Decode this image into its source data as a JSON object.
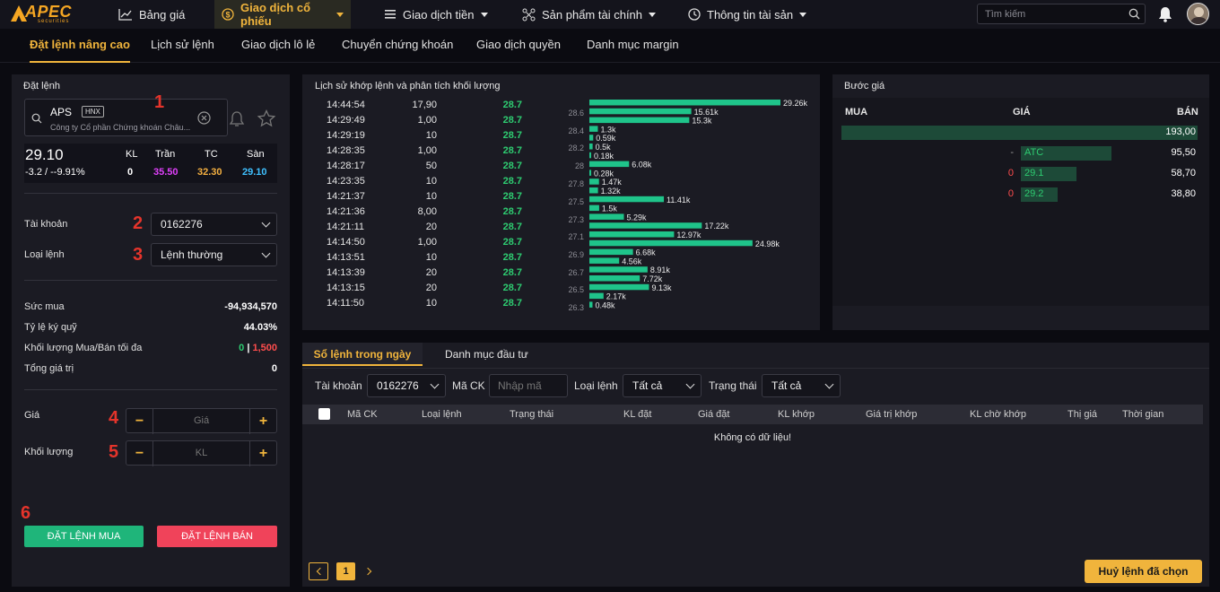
{
  "nav": {
    "logo_text": "APEC",
    "logo_sub": "securities",
    "items": [
      {
        "label": "Bảng giá",
        "icon": "chart-line-icon"
      },
      {
        "label": "Giao dịch cổ phiếu",
        "icon": "dollar-coin-icon"
      },
      {
        "label": "Giao dịch tiền",
        "icon": "list-icon"
      },
      {
        "label": "Sản phẩm tài chính",
        "icon": "network-icon"
      },
      {
        "label": "Thông tin tài sản",
        "icon": "clock-icon"
      }
    ],
    "search_placeholder": "Tìm kiếm"
  },
  "subnav": {
    "tabs": [
      "Đặt lệnh nâng cao",
      "Lịch sử lệnh",
      "Giao dịch lô lẻ",
      "Chuyển chứng khoán",
      "Giao dịch quyền",
      "Danh mục margin"
    ]
  },
  "order": {
    "title": "Đặt lệnh",
    "step_markers": [
      "1",
      "2",
      "3",
      "4",
      "5",
      "6"
    ],
    "symbol": "APS",
    "exchange": "HNX",
    "company": "Công ty Cổ phần Chứng khoán Châu...",
    "price": "29.10",
    "change": "-3.2 / --9.91%",
    "kl_label": "KL",
    "kl_value": "0",
    "tran_label": "Trần",
    "tran_value": "35.50",
    "tc_label": "TC",
    "tc_value": "32.30",
    "san_label": "Sàn",
    "san_value": "29.10",
    "account_label": "Tài khoản",
    "account_value": "0162276",
    "order_type_label": "Loại lệnh",
    "order_type_value": "Lệnh thường",
    "suc_mua_label": "Sức mua",
    "suc_mua_value": "-94,934,570",
    "ty_le_label": "Tỷ lệ ký quỹ",
    "ty_le_value": "44.03%",
    "max_label": "Khối lượng Mua/Bán tối đa",
    "max_buy": "0",
    "max_sep": " | ",
    "max_sell": "1,500",
    "total_label": "Tổng giá trị",
    "total_value": "0",
    "price_label": "Giá",
    "price_placeholder": "Giá",
    "qty_label": "Khối lượng",
    "qty_placeholder": "KL",
    "minus": "−",
    "plus": "+",
    "buy_button": "ĐẶT LỆNH MUA",
    "sell_button": "ĐẶT LỆNH BÁN"
  },
  "trades": {
    "title": "Lịch sử khớp lệnh và phân tích khối lượng",
    "rows": [
      {
        "time": "14:44:54",
        "vol": "17,90",
        "price": "28.7"
      },
      {
        "time": "14:29:49",
        "vol": "1,00",
        "price": "28.7"
      },
      {
        "time": "14:29:19",
        "vol": "10",
        "price": "28.7"
      },
      {
        "time": "14:28:35",
        "vol": "1,00",
        "price": "28.7"
      },
      {
        "time": "14:28:17",
        "vol": "50",
        "price": "28.7"
      },
      {
        "time": "14:23:35",
        "vol": "10",
        "price": "28.7"
      },
      {
        "time": "14:21:37",
        "vol": "10",
        "price": "28.7"
      },
      {
        "time": "14:21:36",
        "vol": "8,00",
        "price": "28.7"
      },
      {
        "time": "14:21:11",
        "vol": "20",
        "price": "28.7"
      },
      {
        "time": "14:14:50",
        "vol": "1,00",
        "price": "28.7"
      },
      {
        "time": "14:13:51",
        "vol": "10",
        "price": "28.7"
      },
      {
        "time": "14:13:39",
        "vol": "20",
        "price": "28.7"
      },
      {
        "time": "14:13:15",
        "vol": "20",
        "price": "28.7"
      },
      {
        "time": "14:11:50",
        "vol": "10",
        "price": "28.7"
      }
    ]
  },
  "chart_data": {
    "type": "bar",
    "orientation": "horizontal",
    "price_ticks": [
      "28.6",
      "28.4",
      "28.2",
      "28",
      "27.8",
      "27.5",
      "27.3",
      "27.1",
      "26.9",
      "26.7",
      "26.5",
      "26.3"
    ],
    "bar_color": "#1fc48a",
    "values": [
      29.26,
      15.61,
      15.3,
      1.3,
      0.59,
      0.5,
      0.18,
      6.08,
      0.28,
      1.47,
      1.32,
      11.41,
      1.5,
      5.29,
      17.22,
      12.97,
      24.98,
      6.68,
      4.56,
      8.91,
      7.72,
      9.13,
      2.17,
      0.48
    ],
    "labels": [
      "29.26k",
      "15.61k",
      "15.3k",
      "1.3k",
      "0.59k",
      "0.5k",
      "0.18k",
      "6.08k",
      "0.28k",
      "1.47k",
      "1.32k",
      "11.41k",
      "1.5k",
      "5.29k",
      "17.22k",
      "12.97k",
      "24.98k",
      "6.68k",
      "4.56k",
      "8.91k",
      "7.72k",
      "9.13k",
      "2.17k",
      "0.48k"
    ],
    "xlim": [
      0,
      29.26
    ]
  },
  "depth": {
    "title": "Bước giá",
    "col_buy": "MUA",
    "col_price": "GIÁ",
    "col_sell": "BÁN",
    "rows": [
      {
        "buy": "",
        "price": "",
        "sell": "193,00",
        "fill": 1.0
      },
      {
        "buy": "-",
        "price": "ATC",
        "sell": "95,50",
        "fill": 0.49
      },
      {
        "buy": "0",
        "price": "29.1",
        "sell": "58,70",
        "fill": 0.3
      },
      {
        "buy": "0",
        "price": "29.2",
        "sell": "38,80",
        "fill": 0.2
      }
    ]
  },
  "orders": {
    "tabs": [
      "Sổ lệnh trong ngày",
      "Danh mục đầu tư"
    ],
    "account_label": "Tài khoản",
    "account_value": "0162276",
    "ma_ck_label": "Mã CK",
    "ma_ck_placeholder": "Nhập mã",
    "type_label": "Loại lệnh",
    "type_value": "Tất cả",
    "status_label": "Trạng thái",
    "status_value": "Tất cả",
    "columns": [
      "Mã CK",
      "Loại lệnh",
      "Trạng thái",
      "KL đặt",
      "Giá đặt",
      "KL khớp",
      "Giá trị khớp",
      "KL chờ khớp",
      "Thị giá",
      "Thời gian"
    ],
    "empty": "Không có dữ liệu!",
    "page": "1",
    "cancel_button": "Huỷ lệnh đã chọn"
  }
}
